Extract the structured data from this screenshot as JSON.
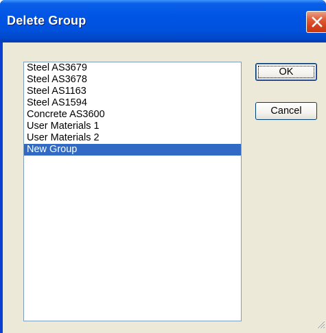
{
  "window": {
    "title": "Delete Group"
  },
  "list": {
    "items": [
      {
        "label": "Steel AS3679"
      },
      {
        "label": "Steel AS3678"
      },
      {
        "label": "Steel AS1163"
      },
      {
        "label": "Steel AS1594"
      },
      {
        "label": "Concrete AS3600"
      },
      {
        "label": "User Materials 1"
      },
      {
        "label": "User Materials 2"
      },
      {
        "label": "New Group"
      }
    ],
    "selected_label": "New Group"
  },
  "buttons": {
    "ok_label": "OK",
    "cancel_label": "Cancel"
  },
  "icons": {
    "close": "close-icon",
    "resize": "size-grip-icon"
  },
  "colors": {
    "titlebar": "#0054e3",
    "selection": "#316ac5",
    "dialog_face": "#ece9d8",
    "close_button": "#d2431c"
  }
}
